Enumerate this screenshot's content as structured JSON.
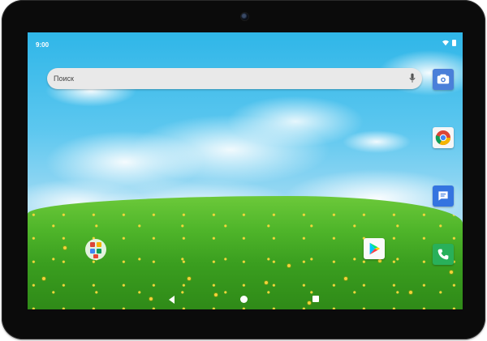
{
  "statusbar": {
    "time": "9:00",
    "icons": [
      "wifi-icon",
      "battery-icon"
    ]
  },
  "search": {
    "placeholder": "Поиск",
    "mic_icon": "mic-icon"
  },
  "home_apps": [
    {
      "name": "camera",
      "icon": "camera-icon",
      "color": "#4a7fd9"
    },
    {
      "name": "chrome",
      "icon": "chrome-icon",
      "color": "#f6f6f6"
    },
    {
      "name": "messages",
      "icon": "messages-icon",
      "color": "#3474e0"
    },
    {
      "name": "play-store",
      "icon": "play-store-icon",
      "color": "#fafafa"
    },
    {
      "name": "phone",
      "icon": "phone-icon",
      "color": "#29b05a"
    },
    {
      "name": "google-folder",
      "icon": "folder-icon",
      "color": "#ffffff"
    }
  ],
  "navbar": {
    "icons": [
      "back-icon",
      "home-icon",
      "recents-icon"
    ]
  },
  "colors": {
    "bezel": "#0b0b0b",
    "sky": "#2fb6e8",
    "grass": "#4fb52a",
    "flower": "#f3d23b"
  }
}
